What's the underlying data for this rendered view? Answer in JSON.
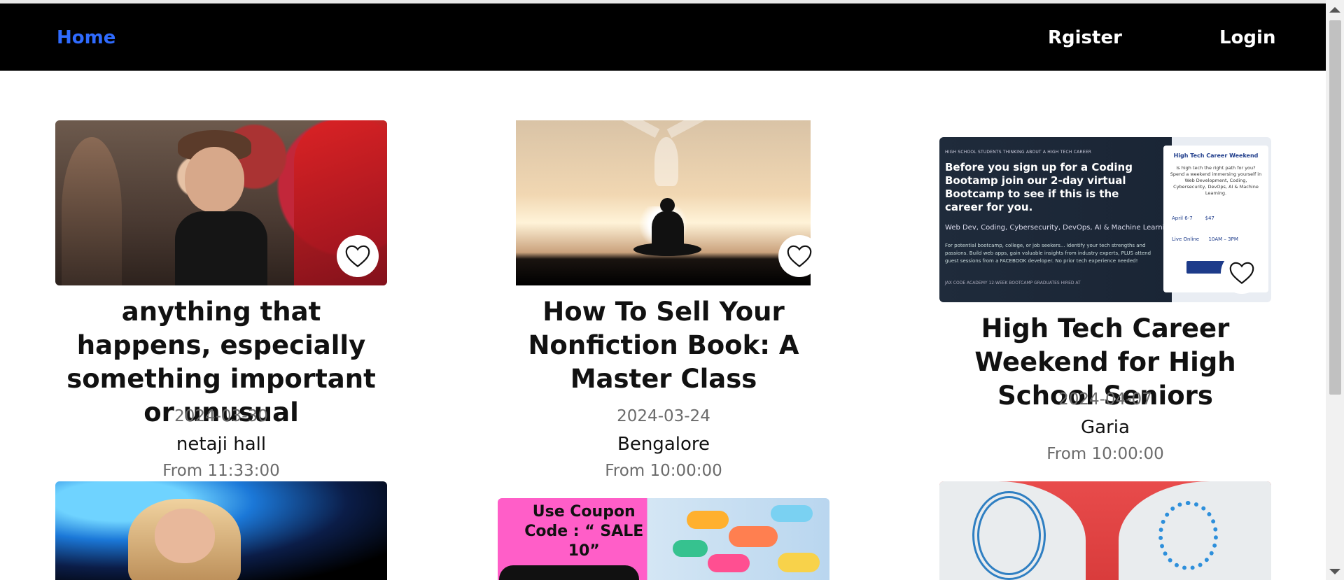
{
  "nav": {
    "home_label": "Home",
    "register_label": "Rgister",
    "login_label": "Login"
  },
  "colors": {
    "navbar_bg": "#000000",
    "nav_active": "#2f6bff",
    "nav_text": "#ffffff",
    "date_text": "#6b6b6b"
  },
  "events": [
    {
      "title": "anything that happens, especially something important or unusual",
      "date": "2024-03-30",
      "venue": "netaji hall",
      "time": "From 11:33:00",
      "favorite_icon": "heart-outline-icon"
    },
    {
      "title": "How To Sell Your Nonfiction Book: A Master Class",
      "date": "2024-03-24",
      "venue": "Bengalore",
      "time": "From 10:00:00",
      "favorite_icon": "heart-outline-icon"
    },
    {
      "title": "High Tech Career Weekend for High School Seniors",
      "date": "2024-04-07",
      "venue": "Garia",
      "time": "From 10:00:00",
      "favorite_icon": "heart-outline-icon"
    }
  ],
  "image_text": {
    "tech_kicker": "HIGH SCHOOL STUDENTS THINKING ABOUT A HIGH TECH CAREER",
    "tech_headline": "Before you sign up for a Coding Bootamp join our 2-day virtual Bootcamp to see if this is the career for you.",
    "tech_topics": "Web Dev, Coding, Cybersecurity, DevOps, AI & Machine Learning",
    "tech_body": "For potential bootcamp, college, or job seekers... Identify your tech strengths and passions. Build web apps, gain valuable insights from industry experts, PLUS attend guest sessions from a FACEBOOK developer. No prior tech experience needed!",
    "tech_footer": "JAX CODE ACADEMY 12-WEEK BOOTCAMP GRADUATES HIRED AT",
    "tech_panel_title": "High Tech Career Weekend",
    "tech_panel_body": "Is high tech the right path for you? Spend a weekend immersing yourself in Web Development, Coding, Cybersecurity, DevOps, AI & Machine Learning.",
    "tech_dates": "April 6-7",
    "tech_price": "$47",
    "tech_venue": "Live Online",
    "tech_time": "10AM – 3PM",
    "coupon": "Use Coupon Code : “ SALE 10”"
  }
}
